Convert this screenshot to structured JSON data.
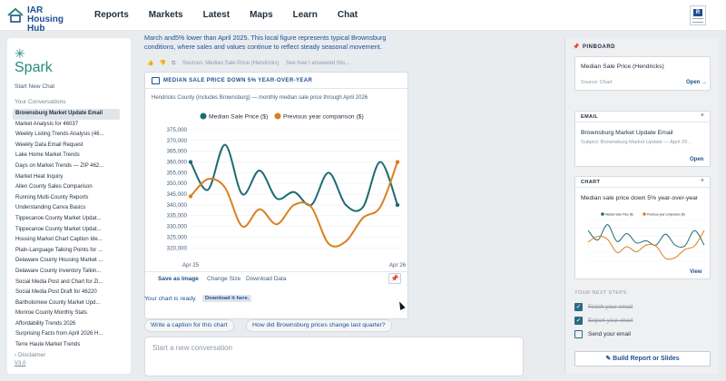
{
  "nav": {
    "logo_line1": "IAR",
    "logo_line2": "Housing Hub",
    "items": [
      "Reports",
      "Markets",
      "Latest",
      "Maps",
      "Learn",
      "Chat"
    ],
    "badge_letter": "R"
  },
  "sidebar": {
    "title": "Spark",
    "new_chat": "Start New Chat",
    "conversations_heading": "Your Conversations",
    "conversations": [
      "Brownsburg Market Update Email",
      "Market Analysis for 46037",
      "Weekly Listing Trends Analysis (46...",
      "Weekly Data Email Request",
      "Lake Home Market Trends",
      "Days on Market Trends — ZIP 462...",
      "Market Heat Inquiry",
      "Allen County Sales Comparison",
      "Running Multi-County Reports",
      "Understanding Canva Basics",
      "Tippecanoe County Market Updat...",
      "Tippecanoe County Market Updat...",
      "Housing Market Chart Caption Ide...",
      "Plain-Language Talking Points for ...",
      "Delaware County Housing Market ...",
      "Delaware County Inventory Talkin...",
      "Social Media Post and Chart for Zi...",
      "Social Media Post Draft for 46220",
      "Bartholomew County Market Upd...",
      "Monroe County Monthly Stats",
      "Affordability Trends 2026",
      "Surprising Facts from April 2026 H...",
      "Terre Haute Market Trends"
    ],
    "disclaimer": "Disclaimer",
    "version": "V3.0"
  },
  "main": {
    "intro": "March and5% lower than April 2025. This local figure represents typical Brownsburg conditions, where sales and values continue to reflect steady seasonal movement.",
    "source": "Sources: Median Sale Price (Hendricks)",
    "see_how": "See how I answered this...",
    "chart_card": {
      "header": "MEDIAN SALE PRICE DOWN 5% YEAR-OVER-YEAR",
      "subtitle": "Hendricks County (includes Brownsburg) — monthly median sale price through April 2026",
      "actions": [
        "Save as Image",
        "Change Size",
        "Download Data"
      ]
    },
    "ready_text": "Your chart is ready.",
    "download_label": "Download it here.",
    "suggestions": [
      "Write a caption for this chart",
      "How did Brownsburg prices change last quarter?"
    ],
    "composer_placeholder": "Start a new conversation"
  },
  "pinboard": {
    "heading": "PINBOARD",
    "source_card": {
      "title": "Median Sale Price (Hendricks)",
      "meta": "Source: Chart",
      "link": "Open →"
    },
    "email_card": {
      "kind": "EMAIL",
      "title": "Brownsburg Market Update Email",
      "subject": "Subject: Brownsburg Market Update — April 20...",
      "link": "Open"
    },
    "chart_card": {
      "kind": "CHART",
      "title": "Median sale price down 5% year-over-year",
      "link": "View"
    },
    "steps_heading": "YOUR NEXT STEPS",
    "steps": [
      {
        "label": "Finish your email",
        "done": true
      },
      {
        "label": "Export your chart",
        "done": true
      },
      {
        "label": "Send your email",
        "done": false
      }
    ],
    "build_button": "Build Report or Slides"
  },
  "colors": {
    "series_current": "#1f6b73",
    "series_previous": "#d9801f",
    "brand": "#1d4f91"
  },
  "chart_data": {
    "type": "line",
    "title": "",
    "xlabel": "",
    "ylabel": "",
    "x_tick_labels": [
      "Apr 25",
      "Apr 26"
    ],
    "x": [
      "Apr 25",
      "May 25",
      "Jun 25",
      "Jul 25",
      "Aug 25",
      "Sep 25",
      "Oct 25",
      "Nov 25",
      "Dec 25",
      "Jan 26",
      "Feb 26",
      "Mar 26",
      "Apr 26"
    ],
    "ylim": [
      318000,
      375000
    ],
    "yticks": [
      320000,
      325000,
      330000,
      335000,
      340000,
      345000,
      350000,
      355000,
      360000,
      365000,
      370000,
      375000
    ],
    "ytick_labels": [
      "320,000",
      "325,000",
      "330,000",
      "335,000",
      "340,000",
      "345,000",
      "350,000",
      "355,000",
      "360,000",
      "365,000",
      "370,000",
      "375,000"
    ],
    "grid": true,
    "legend": "top",
    "series": [
      {
        "name": "Median Sale Price ($)",
        "values": [
          360000,
          347000,
          368000,
          345000,
          356000,
          343000,
          346000,
          340000,
          355000,
          340000,
          339000,
          360000,
          340000
        ]
      },
      {
        "name": "Previous year comparison ($)",
        "values": [
          344000,
          352000,
          348000,
          330000,
          338000,
          331000,
          340000,
          339000,
          322000,
          323000,
          334000,
          339000,
          360000
        ]
      }
    ]
  }
}
